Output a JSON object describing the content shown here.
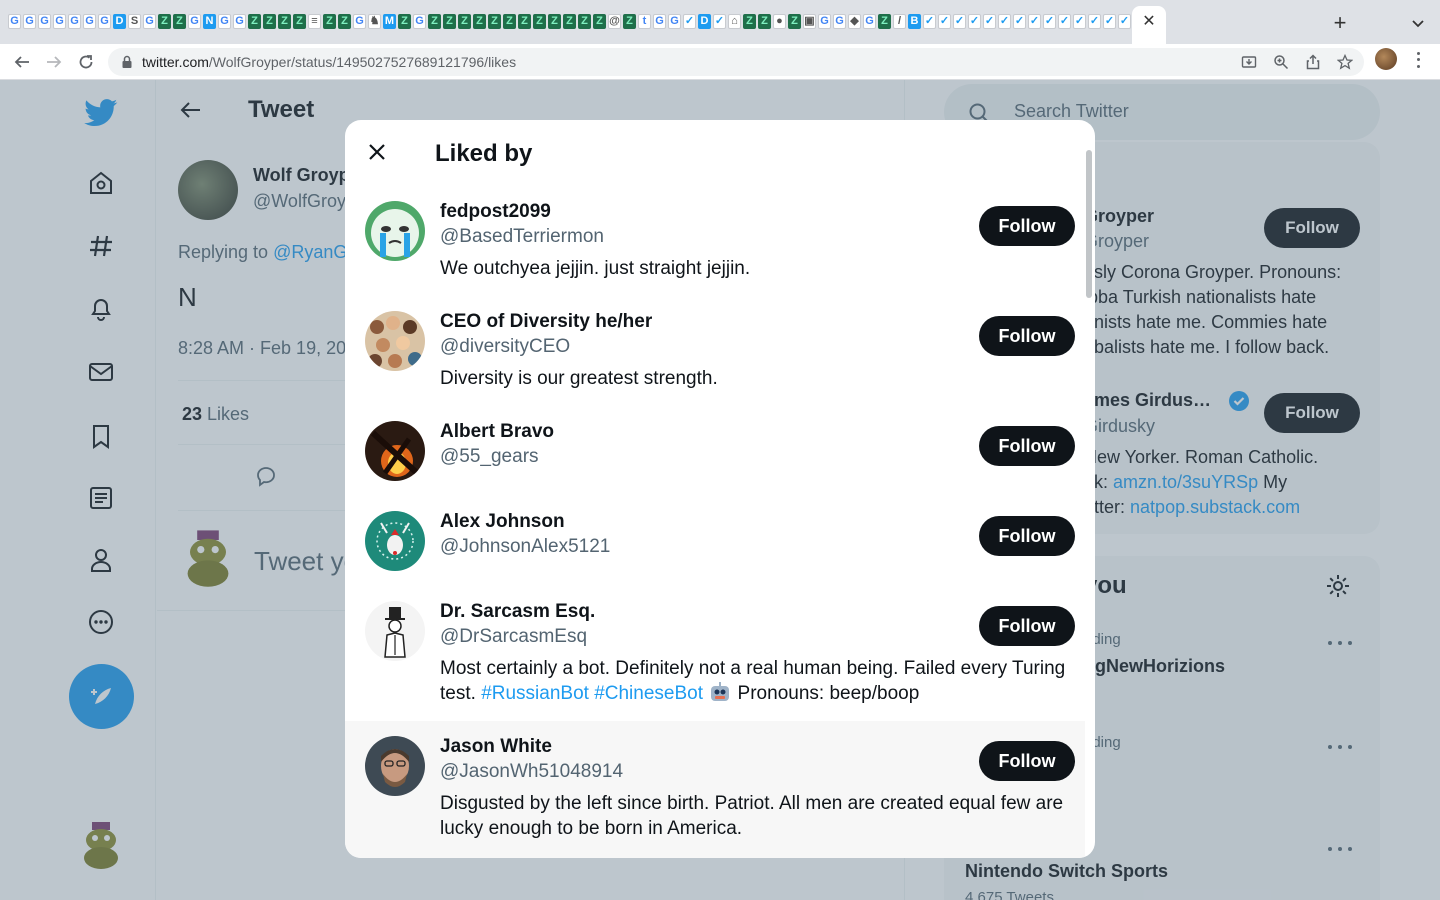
{
  "browser": {
    "url_host": "twitter.com",
    "url_path": "/WolfGroyper/status/1495027527689121796/likes"
  },
  "main": {
    "title": "Tweet",
    "author_name": "Wolf Groyp",
    "author_handle": "@WolfGroy",
    "replying_prefix": "Replying to ",
    "replying_handle": "@RyanG",
    "tweet_text": "N",
    "tweet_time": "8:28 AM · Feb 19, 20",
    "likes_number": "23",
    "likes_word": " Likes",
    "composer_placeholder": "Tweet yo"
  },
  "right": {
    "search_placeholder": "Search Twitter",
    "panel1_title": "eople",
    "person1_name": "Groyper",
    "person1_handle": "Groyper",
    "person1_bio_lines": [
      "usly Corona Groyper. Pronouns:",
      "ibba Turkish nationalists hate",
      "onists hate me. Commies hate",
      "obalists hate me. I follow back."
    ],
    "person2_name": "ames Girdus…",
    "person2_handle": "Girdusky",
    "person2_bio_line1": " New Yorker. Roman Catholic.",
    "person2_bio_line2_prefix": "ok: ",
    "person2_bio_link1": "amzn.to/3suYRSp",
    "person2_bio_line2_suffix": " My",
    "person2_bio_line3_prefix": "etter: ",
    "person2_bio_link2": "natpop.substack.com",
    "follow_label": "Follow",
    "panel2_title": "you",
    "trend1_label": "nding",
    "trend1_name": "ngNewHorizions",
    "trend2_label": "nding",
    "trend3_name": "Nintendo Switch Sports",
    "trend3_count": "4,675 Tweets"
  },
  "modal": {
    "title": "Liked by",
    "follow_label": "Follow",
    "users": [
      {
        "name": "fedpost2099",
        "handle": "@BasedTerriermon",
        "bio": "We outchyea jejjin. just straight jejjin."
      },
      {
        "name": "CEO of Diversity he/her",
        "handle": "@diversityCEO",
        "bio": "Diversity is our greatest strength."
      },
      {
        "name": "Albert Bravo",
        "handle": "@55_gears",
        "bio": ""
      },
      {
        "name": "Alex Johnson",
        "handle": "@JohnsonAlex5121",
        "bio": ""
      },
      {
        "name": "Dr. Sarcasm Esq.",
        "handle": "@DrSarcasmEsq",
        "bio_prefix": "Most certainly a bot. Definitely not a real human being. Failed every Turing test. ",
        "bio_tag1": "#RussianBot",
        "bio_tag2": "#ChineseBot",
        "bio_suffix": " Pronouns: beep/boop"
      },
      {
        "name": "Jason White",
        "handle": "@JasonWh51048914",
        "bio": "Disgusted by the left since birth. Patriot. All men are created equal few are lucky enough to be born in America."
      }
    ]
  },
  "colors": {
    "twitter_blue": "#1d9bf0",
    "text_primary": "#0f1419",
    "text_secondary": "#536471",
    "follow_button": "#0f1419"
  }
}
